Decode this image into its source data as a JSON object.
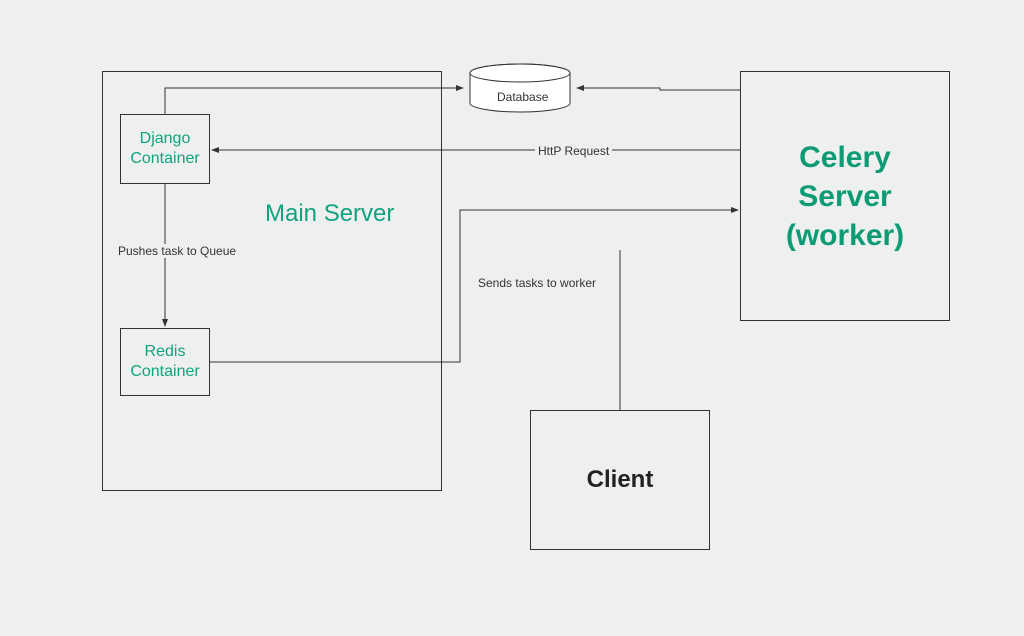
{
  "nodes": {
    "database": {
      "label": "Database"
    },
    "django": {
      "label_line1": "Django",
      "label_line2": "Container"
    },
    "redis": {
      "label_line1": "Redis",
      "label_line2": "Container"
    },
    "main_server": {
      "label": "Main Server"
    },
    "celery": {
      "label_line1": "Celery",
      "label_line2": "Server",
      "label_line3": "(worker)"
    },
    "client": {
      "label": "Client"
    }
  },
  "edges": {
    "django_to_redis": {
      "label": "Pushes task to Queue"
    },
    "redis_to_celery": {
      "label": "Sends tasks to worker"
    },
    "celery_to_django": {
      "label": "HttP Request"
    }
  },
  "chart_data": {
    "type": "diagram",
    "title": "",
    "nodes": [
      {
        "id": "main_server",
        "label": "Main Server",
        "type": "container"
      },
      {
        "id": "django",
        "label": "Django Container",
        "parent": "main_server"
      },
      {
        "id": "redis",
        "label": "Redis Container",
        "parent": "main_server"
      },
      {
        "id": "database",
        "label": "Database",
        "type": "cylinder"
      },
      {
        "id": "celery",
        "label": "Celery Server (worker)"
      },
      {
        "id": "client",
        "label": "Client"
      }
    ],
    "edges": [
      {
        "from": "django",
        "to": "database",
        "label": "",
        "bidirectional": false
      },
      {
        "from": "celery",
        "to": "database",
        "label": "",
        "bidirectional": false
      },
      {
        "from": "django",
        "to": "redis",
        "label": "Pushes task to Queue",
        "bidirectional": false
      },
      {
        "from": "redis",
        "to": "celery",
        "label": "Sends tasks to worker",
        "bidirectional": false
      },
      {
        "from": "celery",
        "to": "django",
        "label": "HttP Request",
        "bidirectional": false
      },
      {
        "from": "client",
        "to": "celery",
        "label": "",
        "bidirectional": false
      }
    ]
  }
}
